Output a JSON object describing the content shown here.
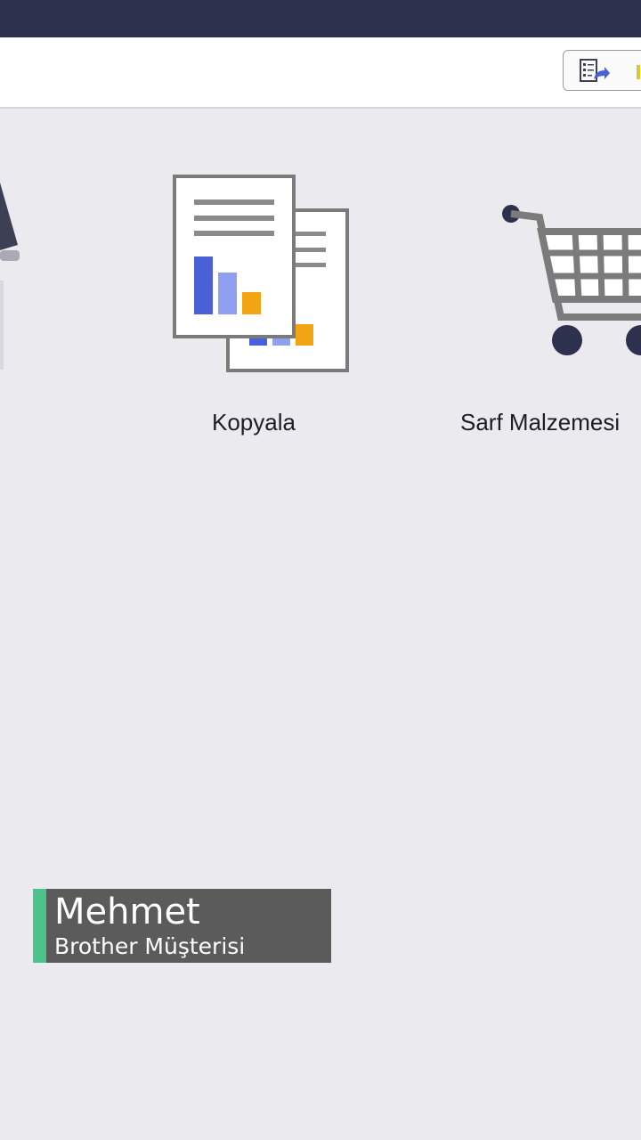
{
  "toolbar": {
    "button_icon": "report-export-icon"
  },
  "tiles": [
    {
      "label": "Kopyala",
      "icon": "copy-report-icon"
    },
    {
      "label": "Sarf Malzemesi",
      "icon": "shopping-cart-icon"
    }
  ],
  "caption": {
    "name": "Mehmet",
    "role": "Brother Müşterisi"
  },
  "colors": {
    "topbar": "#2e314d",
    "background": "#ebebef",
    "caption_accent": "#4cc38a",
    "caption_bg": "#5b5b5b",
    "bar_blue": "#4a60d8",
    "bar_light_blue": "#8ea0ef",
    "bar_orange": "#f2a412",
    "cart_dark": "#2e314d"
  }
}
